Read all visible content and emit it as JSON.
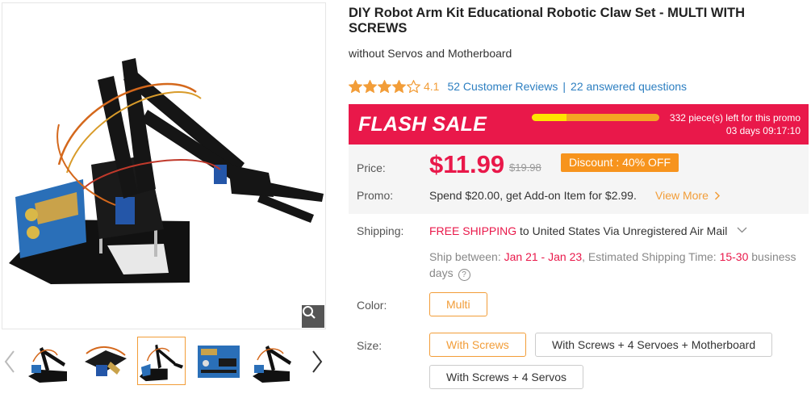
{
  "product": {
    "title": "DIY Robot Arm Kit Educational Robotic Claw Set - MULTI WITH SCREWS",
    "subtitle": "without Servos and Motherboard"
  },
  "rating": {
    "value": "4.1",
    "stars": 4.1,
    "reviews_link": "52 Customer Reviews",
    "separator": "|",
    "questions_link": "22 answered questions"
  },
  "flash_sale": {
    "label": "FLASH SALE",
    "stock_left": "332 piece(s) left for this promo",
    "countdown": "03 days 09:17:10",
    "sold_fraction": 0.27
  },
  "pricing": {
    "price_label": "Price:",
    "price": "$11.99",
    "original_price": "$19.98",
    "discount": "Discount : 40% OFF",
    "promo_label": "Promo:",
    "promo_text": "Spend $20.00, get Add-on Item for $2.99.",
    "view_more": "View More"
  },
  "shipping": {
    "label": "Shipping:",
    "free": "FREE SHIPPING",
    "method": " to United States Via Unregistered Air Mail",
    "between_prefix": "Ship between: ",
    "dates": "Jan 21 - Jan 23",
    "est_prefix": ", Estimated Shipping Time: ",
    "est_days": "15-30",
    "est_suffix": " business days"
  },
  "options": {
    "color_label": "Color:",
    "colors": [
      "Multi"
    ],
    "size_label": "Size:",
    "sizes": [
      "With Screws",
      "With Screws + 4 Servoes + Motherboard",
      "With Screws + 4 Servos"
    ]
  },
  "icons": {
    "zoom": "magnifier-icon",
    "prev": "chevron-left-icon",
    "next": "chevron-right-icon",
    "dropdown": "chevron-down-icon",
    "help": "question-circle-icon"
  },
  "colors": {
    "accent_red": "#e9184a",
    "orange": "#f29d38",
    "discount_orange": "#f7941d",
    "link_blue": "#2d7fc1",
    "star": "#f29d38"
  }
}
